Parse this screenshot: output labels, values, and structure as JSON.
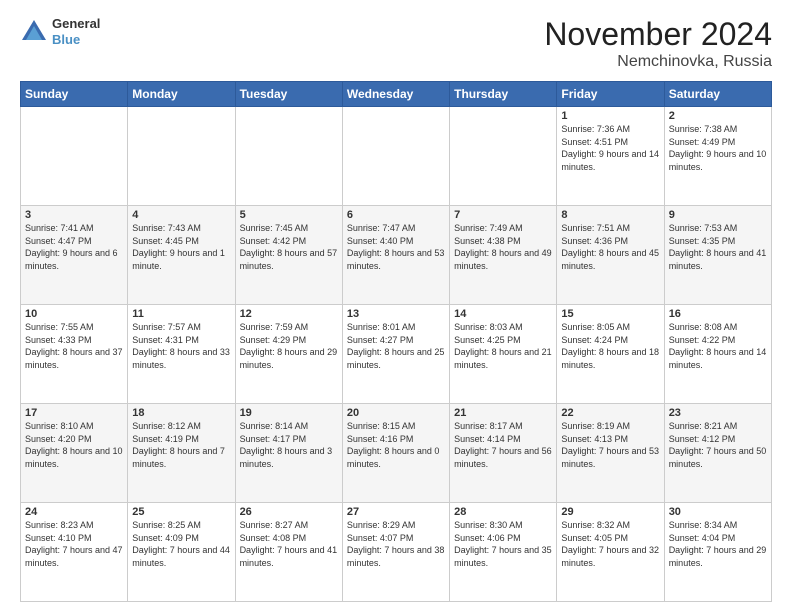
{
  "logo": {
    "line1": "General",
    "line2": "Blue"
  },
  "title": "November 2024",
  "subtitle": "Nemchinovka, Russia",
  "days_header": [
    "Sunday",
    "Monday",
    "Tuesday",
    "Wednesday",
    "Thursday",
    "Friday",
    "Saturday"
  ],
  "weeks": [
    [
      {
        "day": "",
        "info": ""
      },
      {
        "day": "",
        "info": ""
      },
      {
        "day": "",
        "info": ""
      },
      {
        "day": "",
        "info": ""
      },
      {
        "day": "",
        "info": ""
      },
      {
        "day": "1",
        "info": "Sunrise: 7:36 AM\nSunset: 4:51 PM\nDaylight: 9 hours and 14 minutes."
      },
      {
        "day": "2",
        "info": "Sunrise: 7:38 AM\nSunset: 4:49 PM\nDaylight: 9 hours and 10 minutes."
      }
    ],
    [
      {
        "day": "3",
        "info": "Sunrise: 7:41 AM\nSunset: 4:47 PM\nDaylight: 9 hours and 6 minutes."
      },
      {
        "day": "4",
        "info": "Sunrise: 7:43 AM\nSunset: 4:45 PM\nDaylight: 9 hours and 1 minute."
      },
      {
        "day": "5",
        "info": "Sunrise: 7:45 AM\nSunset: 4:42 PM\nDaylight: 8 hours and 57 minutes."
      },
      {
        "day": "6",
        "info": "Sunrise: 7:47 AM\nSunset: 4:40 PM\nDaylight: 8 hours and 53 minutes."
      },
      {
        "day": "7",
        "info": "Sunrise: 7:49 AM\nSunset: 4:38 PM\nDaylight: 8 hours and 49 minutes."
      },
      {
        "day": "8",
        "info": "Sunrise: 7:51 AM\nSunset: 4:36 PM\nDaylight: 8 hours and 45 minutes."
      },
      {
        "day": "9",
        "info": "Sunrise: 7:53 AM\nSunset: 4:35 PM\nDaylight: 8 hours and 41 minutes."
      }
    ],
    [
      {
        "day": "10",
        "info": "Sunrise: 7:55 AM\nSunset: 4:33 PM\nDaylight: 8 hours and 37 minutes."
      },
      {
        "day": "11",
        "info": "Sunrise: 7:57 AM\nSunset: 4:31 PM\nDaylight: 8 hours and 33 minutes."
      },
      {
        "day": "12",
        "info": "Sunrise: 7:59 AM\nSunset: 4:29 PM\nDaylight: 8 hours and 29 minutes."
      },
      {
        "day": "13",
        "info": "Sunrise: 8:01 AM\nSunset: 4:27 PM\nDaylight: 8 hours and 25 minutes."
      },
      {
        "day": "14",
        "info": "Sunrise: 8:03 AM\nSunset: 4:25 PM\nDaylight: 8 hours and 21 minutes."
      },
      {
        "day": "15",
        "info": "Sunrise: 8:05 AM\nSunset: 4:24 PM\nDaylight: 8 hours and 18 minutes."
      },
      {
        "day": "16",
        "info": "Sunrise: 8:08 AM\nSunset: 4:22 PM\nDaylight: 8 hours and 14 minutes."
      }
    ],
    [
      {
        "day": "17",
        "info": "Sunrise: 8:10 AM\nSunset: 4:20 PM\nDaylight: 8 hours and 10 minutes."
      },
      {
        "day": "18",
        "info": "Sunrise: 8:12 AM\nSunset: 4:19 PM\nDaylight: 8 hours and 7 minutes."
      },
      {
        "day": "19",
        "info": "Sunrise: 8:14 AM\nSunset: 4:17 PM\nDaylight: 8 hours and 3 minutes."
      },
      {
        "day": "20",
        "info": "Sunrise: 8:15 AM\nSunset: 4:16 PM\nDaylight: 8 hours and 0 minutes."
      },
      {
        "day": "21",
        "info": "Sunrise: 8:17 AM\nSunset: 4:14 PM\nDaylight: 7 hours and 56 minutes."
      },
      {
        "day": "22",
        "info": "Sunrise: 8:19 AM\nSunset: 4:13 PM\nDaylight: 7 hours and 53 minutes."
      },
      {
        "day": "23",
        "info": "Sunrise: 8:21 AM\nSunset: 4:12 PM\nDaylight: 7 hours and 50 minutes."
      }
    ],
    [
      {
        "day": "24",
        "info": "Sunrise: 8:23 AM\nSunset: 4:10 PM\nDaylight: 7 hours and 47 minutes."
      },
      {
        "day": "25",
        "info": "Sunrise: 8:25 AM\nSunset: 4:09 PM\nDaylight: 7 hours and 44 minutes."
      },
      {
        "day": "26",
        "info": "Sunrise: 8:27 AM\nSunset: 4:08 PM\nDaylight: 7 hours and 41 minutes."
      },
      {
        "day": "27",
        "info": "Sunrise: 8:29 AM\nSunset: 4:07 PM\nDaylight: 7 hours and 38 minutes."
      },
      {
        "day": "28",
        "info": "Sunrise: 8:30 AM\nSunset: 4:06 PM\nDaylight: 7 hours and 35 minutes."
      },
      {
        "day": "29",
        "info": "Sunrise: 8:32 AM\nSunset: 4:05 PM\nDaylight: 7 hours and 32 minutes."
      },
      {
        "day": "30",
        "info": "Sunrise: 8:34 AM\nSunset: 4:04 PM\nDaylight: 7 hours and 29 minutes."
      }
    ]
  ]
}
